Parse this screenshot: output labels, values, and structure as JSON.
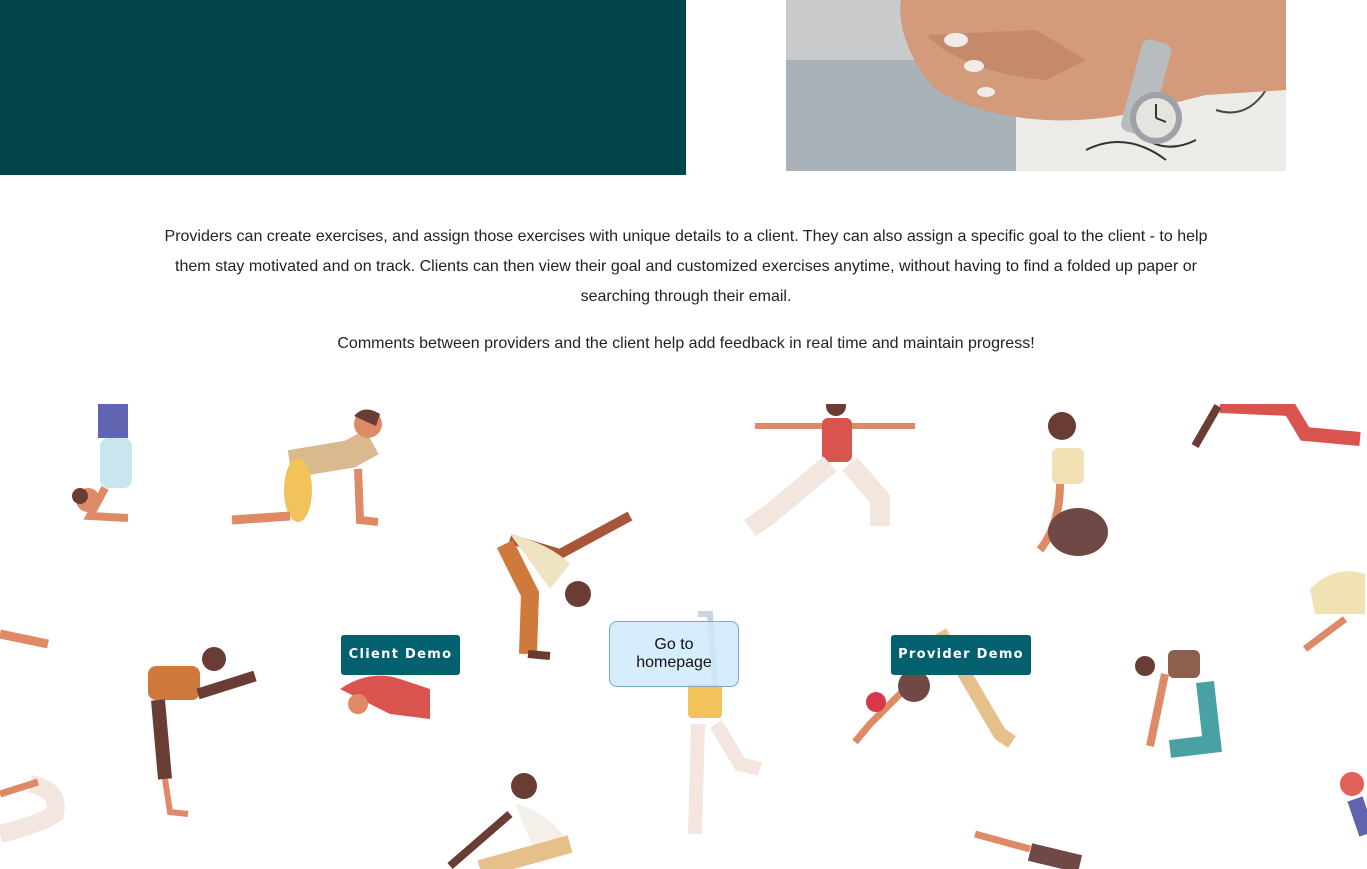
{
  "hero": {
    "image": "hand-with-watch-photo",
    "colors": {
      "teal_block": "#02444c"
    }
  },
  "intro": {
    "paragraph1": "Providers can create exercises, and assign those exercises with unique details to a client. They can also assign a specific goal to the client - to help them stay motivated and on track. Clients can then view their goal and customized exercises anytime, without having to find a folded up paper or searching through their email.",
    "paragraph2": "Comments between providers and the client help add feedback in real time and maintain progress!"
  },
  "demo": {
    "client_label": "Client Demo",
    "provider_label": "Provider Demo",
    "homepage_label": "Go to homepage",
    "colors": {
      "demo_button": "#03606e",
      "homepage_button": "#cde9fa"
    }
  },
  "background": {
    "pattern": "yoga-poses-illustration"
  }
}
